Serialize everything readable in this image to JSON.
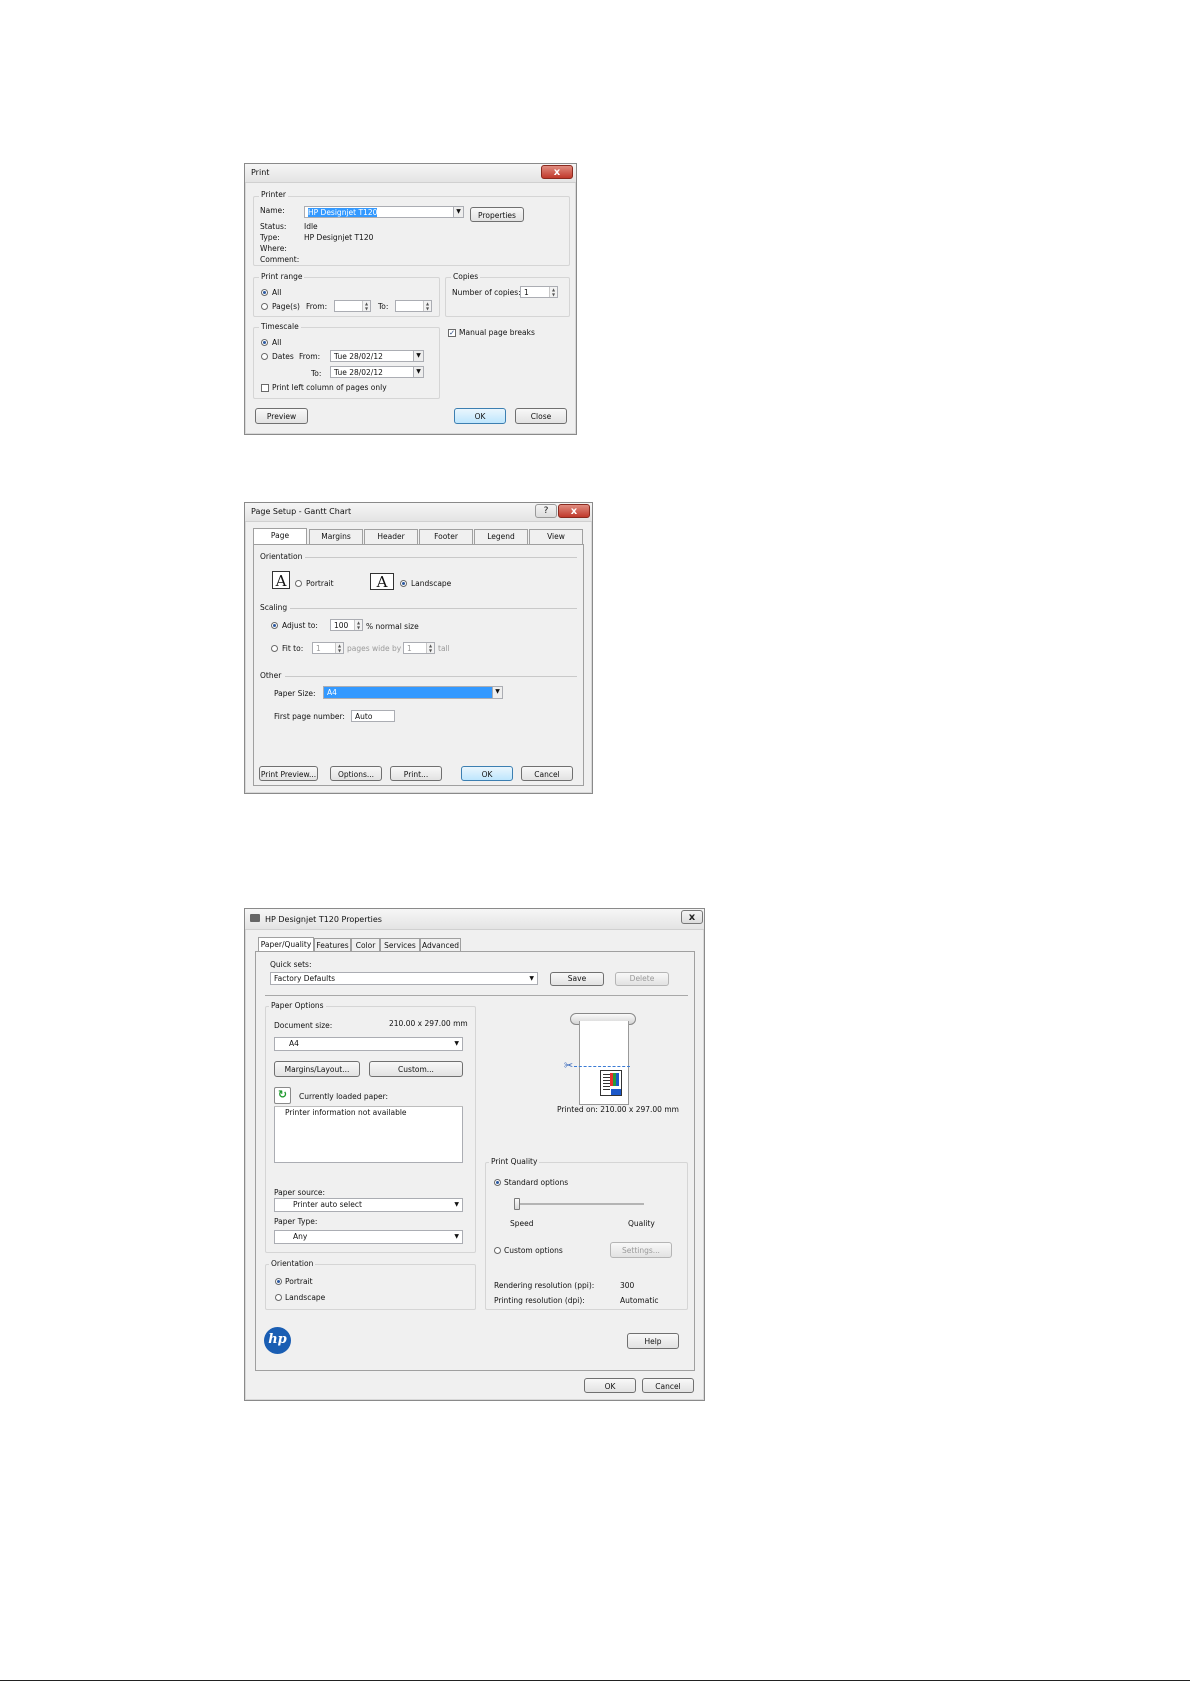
{
  "print_dialog": {
    "title": "Print",
    "close_glyph": "x",
    "printer_group": "Printer",
    "name_label": "Name:",
    "name_value": "HP Designjet T120",
    "properties_button": "Properties",
    "status_label": "Status:",
    "status_value": "Idle",
    "type_label": "Type:",
    "type_value": "HP Designjet T120",
    "where_label": "Where:",
    "comment_label": "Comment:",
    "print_range_group": "Print range",
    "all_label": "All",
    "pages_label": "Page(s)",
    "from_label": "From:",
    "to_label": "To:",
    "copies_group": "Copies",
    "number_of_copies_label": "Number of copies:",
    "number_of_copies_value": "1",
    "timescale_group": "Timescale",
    "timescale_all_label": "All",
    "dates_label": "Dates",
    "dates_from_label": "From:",
    "dates_from_value": "Tue 28/02/12",
    "dates_to_label": "To:",
    "dates_to_value": "Tue 28/02/12",
    "manual_page_breaks_label": "Manual page breaks",
    "print_left_column_label": "Print left column of pages only",
    "preview_button": "Preview",
    "ok_button": "OK",
    "close_button": "Close"
  },
  "page_setup_dialog": {
    "title": "Page Setup - Gantt Chart",
    "help_glyph": "?",
    "close_glyph": "x",
    "tabs": [
      "Page",
      "Margins",
      "Header",
      "Footer",
      "Legend",
      "View"
    ],
    "orientation_group": "Orientation",
    "portrait_label": "Portrait",
    "landscape_label": "Landscape",
    "scaling_group": "Scaling",
    "adjust_to_label": "Adjust to:",
    "adjust_to_value": "100",
    "normal_size_label": "% normal size",
    "fit_to_label": "Fit to:",
    "fit_wide_value": "1",
    "pages_wide_by_label": "pages wide by",
    "fit_tall_value": "1",
    "tall_label": "tall",
    "other_group": "Other",
    "paper_size_label": "Paper Size:",
    "paper_size_value": "A4",
    "first_page_number_label": "First page number:",
    "first_page_number_value": "Auto",
    "print_preview_button": "Print Preview...",
    "options_button": "Options...",
    "print_button": "Print...",
    "ok_button": "OK",
    "cancel_button": "Cancel"
  },
  "properties_dialog": {
    "title": "HP Designjet T120 Properties",
    "close_glyph": "x",
    "tabs": [
      "Paper/Quality",
      "Features",
      "Color",
      "Services",
      "Advanced"
    ],
    "quick_sets_label": "Quick sets:",
    "quick_sets_value": "Factory Defaults",
    "save_button": "Save",
    "delete_button": "Delete",
    "paper_options_group": "Paper Options",
    "document_size_label": "Document size:",
    "document_size_value": "210.00 x 297.00 mm",
    "document_size_select": "A4",
    "margins_layout_button": "Margins/Layout...",
    "custom_button": "Custom...",
    "currently_loaded_paper_label": "Currently loaded paper:",
    "printer_info_text": "Printer information not available",
    "paper_source_label": "Paper source:",
    "paper_source_value": "Printer auto select",
    "paper_type_label": "Paper Type:",
    "paper_type_value": "Any",
    "orientation_group": "Orientation",
    "portrait_label": "Portrait",
    "landscape_label": "Landscape",
    "printed_on_text": "Printed on: 210.00 x 297.00 mm",
    "print_quality_group": "Print Quality",
    "standard_options_label": "Standard options",
    "quality_slider_level": 0,
    "speed_label": "Speed",
    "quality_label": "Quality",
    "custom_options_label": "Custom options",
    "settings_button": "Settings...",
    "rendering_resolution_label": "Rendering resolution (ppi):",
    "rendering_resolution_value": "300",
    "printing_resolution_label": "Printing resolution (dpi):",
    "printing_resolution_value": "Automatic",
    "help_button": "Help",
    "ok_button": "OK",
    "cancel_button": "Cancel",
    "logo_text": "hp",
    "brand_color": "#1a5eb3"
  }
}
